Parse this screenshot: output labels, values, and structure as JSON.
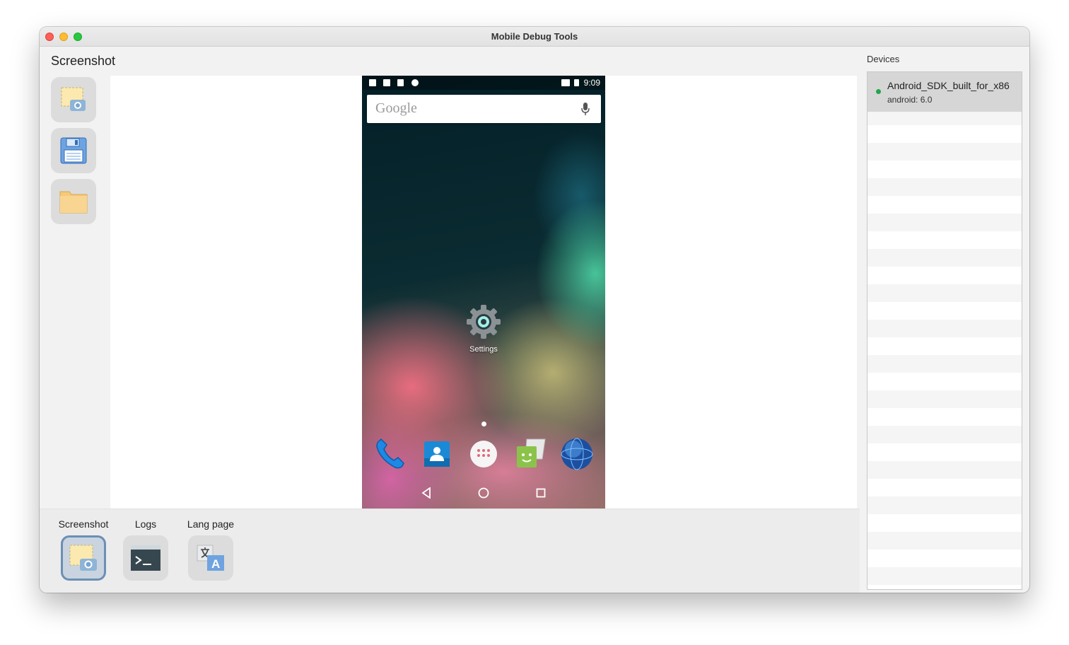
{
  "window": {
    "title": "Mobile Debug Tools"
  },
  "main": {
    "section_title": "Screenshot"
  },
  "phone": {
    "time": "9:09",
    "search_placeholder": "Google",
    "settings_label": "Settings"
  },
  "bottom_tabs": [
    {
      "label": "Screenshot",
      "icon": "screenshot-icon",
      "active": true
    },
    {
      "label": "Logs",
      "icon": "terminal-icon",
      "active": false
    },
    {
      "label": "Lang page",
      "icon": "translate-icon",
      "active": false
    }
  ],
  "devices": {
    "title": "Devices",
    "items": [
      {
        "name": "Android_SDK_built_for_x86",
        "os": "android: 6.0",
        "status_color": "#21a650"
      }
    ]
  },
  "colors": {
    "accent": "#6b8fb5",
    "online": "#21a650"
  }
}
